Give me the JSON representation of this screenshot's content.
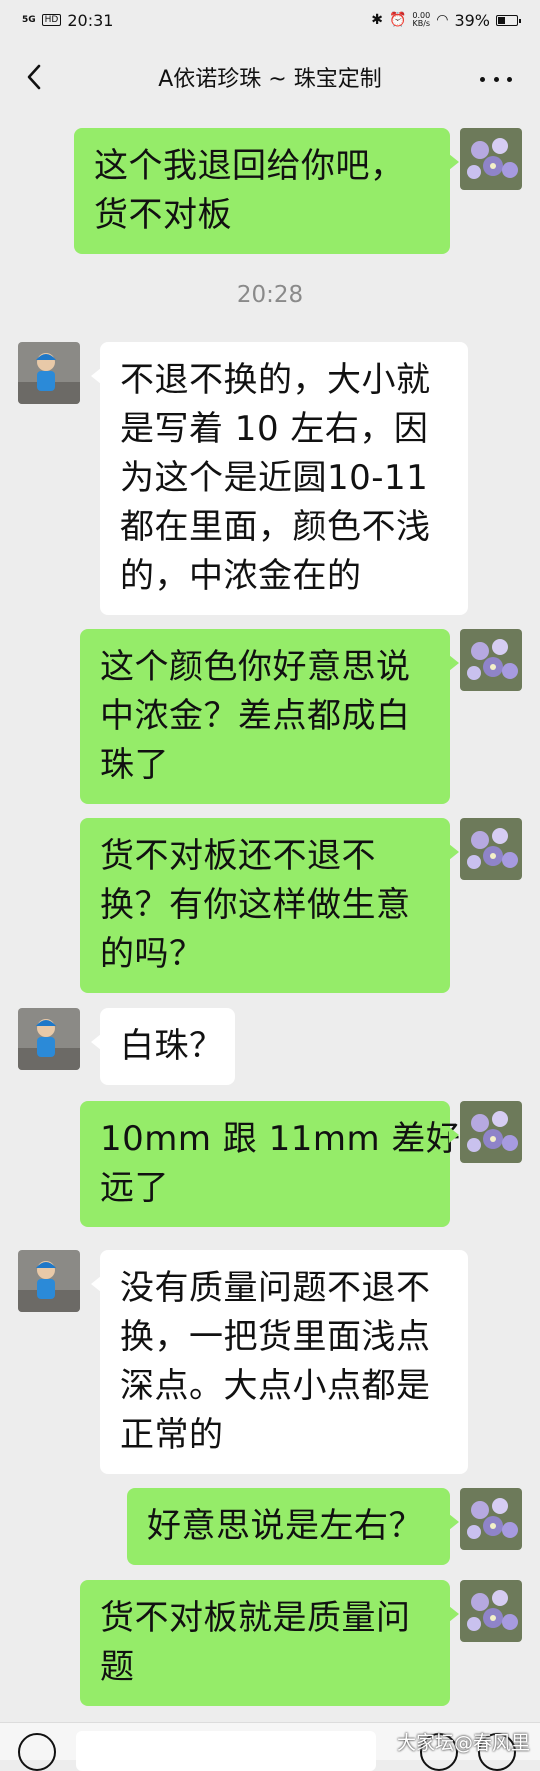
{
  "status_bar": {
    "network": "5G",
    "hd": "HD",
    "time": "20:31",
    "net_speed_value": "0.00",
    "net_speed_unit": "KB/s",
    "battery": "39%",
    "battery_level": 0.39
  },
  "header": {
    "title": "A依诺珍珠 ~ 珠宝定制"
  },
  "timestamp": "20:28",
  "messages": [
    {
      "from": "me",
      "lines": [
        "这个我退回给你吧，",
        "货不对板"
      ]
    },
    {
      "from": "other",
      "lines": [
        "不退不换的，大小就",
        "是写着 10 左右，因",
        "为这个是近圆10-11",
        "都在里面，颜色不浅",
        "的，中浓金在的"
      ]
    },
    {
      "from": "me",
      "lines": [
        "这个颜色你好意思说",
        "中浓金？差点都成白",
        "珠了"
      ]
    },
    {
      "from": "me",
      "lines": [
        "货不对板还不退不",
        "换？有你这样做生意",
        "的吗？"
      ]
    },
    {
      "from": "other",
      "lines": [
        "白珠？"
      ]
    },
    {
      "from": "me",
      "lines": [
        "10mm 跟 11mm 差好",
        "远了"
      ]
    },
    {
      "from": "other",
      "lines": [
        "没有质量问题不退不",
        "换，一把货里面浅点",
        "深点。大点小点都是",
        "正常的"
      ]
    },
    {
      "from": "me",
      "lines": [
        "好意思说是左右？"
      ]
    },
    {
      "from": "me",
      "lines": [
        "货不对板就是质量问",
        "题"
      ]
    }
  ],
  "watermark": "大家坛@春风里",
  "colors": {
    "background": "#ededed",
    "my_bubble": "#95ec69",
    "other_bubble": "#ffffff"
  }
}
